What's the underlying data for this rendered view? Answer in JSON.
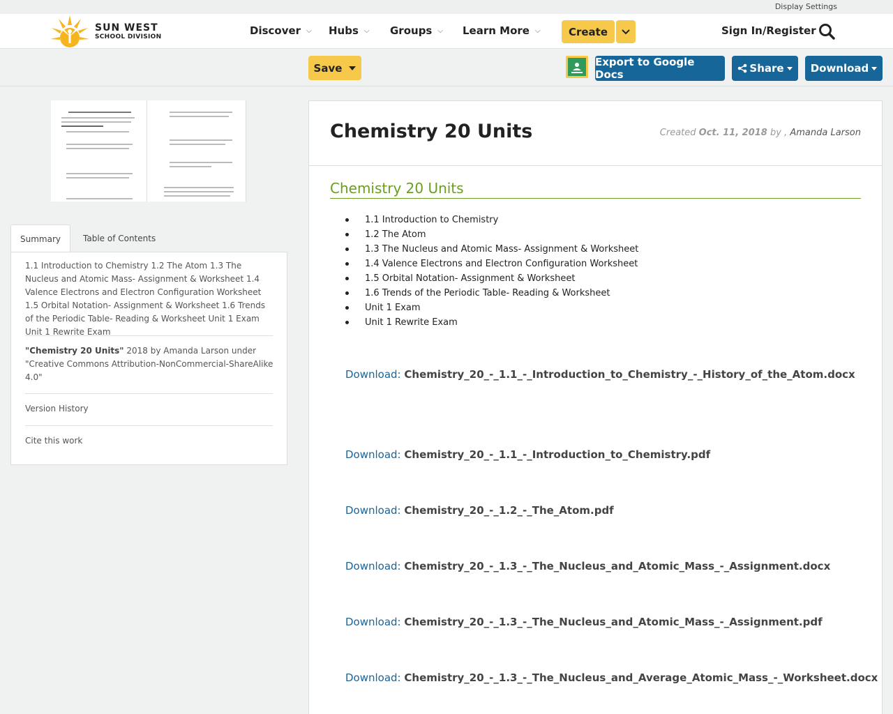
{
  "util": {
    "display_settings": "Display Settings"
  },
  "brand": {
    "line1": "SUN WEST",
    "line2": "SCHOOL DIVISION"
  },
  "nav": {
    "discover": "Discover",
    "hubs": "Hubs",
    "groups": "Groups",
    "learn_more": "Learn More",
    "create": "Create",
    "sign_in": "Sign In/Register"
  },
  "toolbar": {
    "save": "Save",
    "export": "Export to Google Docs",
    "share": "Share",
    "download": "Download"
  },
  "sidebar": {
    "tabs": [
      "Summary",
      "Table of Contents"
    ],
    "summary": "1.1 Introduction to Chemistry 1.2 The Atom 1.3 The Nucleus and Atomic Mass- Assignment & Worksheet 1.4 Valence Electrons and Electron Configuration Worksheet 1.5 Orbital Notation- Assignment & Worksheet 1.6 Trends of the Periodic Table- Reading & Worksheet Unit 1 Exam Unit 1 Rewrite Exam",
    "license_title": "\"Chemistry 20 Units\"",
    "license_rest": " 2018 by Amanda Larson under \"Creative Commons Attribution-NonCommercial-ShareAlike 4.0\"",
    "version_history": "Version History",
    "cite": "Cite this work"
  },
  "document": {
    "title": "Chemistry 20 Units",
    "created_label": "Created",
    "created_date": "Oct. 11, 2018",
    "by": "by ,",
    "author": "Amanda Larson",
    "section_heading": "Chemistry 20 Units",
    "units": [
      "1.1 Introduction to Chemistry",
      "1.2 The Atom",
      "1.3 The Nucleus and Atomic Mass- Assignment & Worksheet",
      "1.4 Valence Electrons and Electron Configuration Worksheet",
      "1.5 Orbital Notation- Assignment & Worksheet",
      "1.6 Trends of the Periodic Table- Reading & Worksheet",
      "Unit 1 Exam",
      "Unit 1 Rewrite Exam"
    ],
    "download_label": "Download:",
    "downloads": [
      "Chemistry_20_-_1.1_-_Introduction_to_Chemistry_-_History_of_the_Atom.docx",
      "Chemistry_20_-_1.1_-_Introduction_to_Chemistry.pdf",
      "Chemistry_20_-_1.2_-_The_Atom.pdf",
      "Chemistry_20_-_1.3_-_The_Nucleus_and_Atomic_Mass_-_Assignment.docx",
      "Chemistry_20_-_1.3_-_The_Nucleus_and_Atomic_Mass_-_Assignment.pdf",
      "Chemistry_20_-_1.3_-_The_Nucleus_and_Average_Atomic_Mass_-_Worksheet.docx"
    ]
  },
  "colors": {
    "accent_yellow": "#f6c94a",
    "brand_blue": "#17669a",
    "heading_green": "#6a9e1f"
  }
}
